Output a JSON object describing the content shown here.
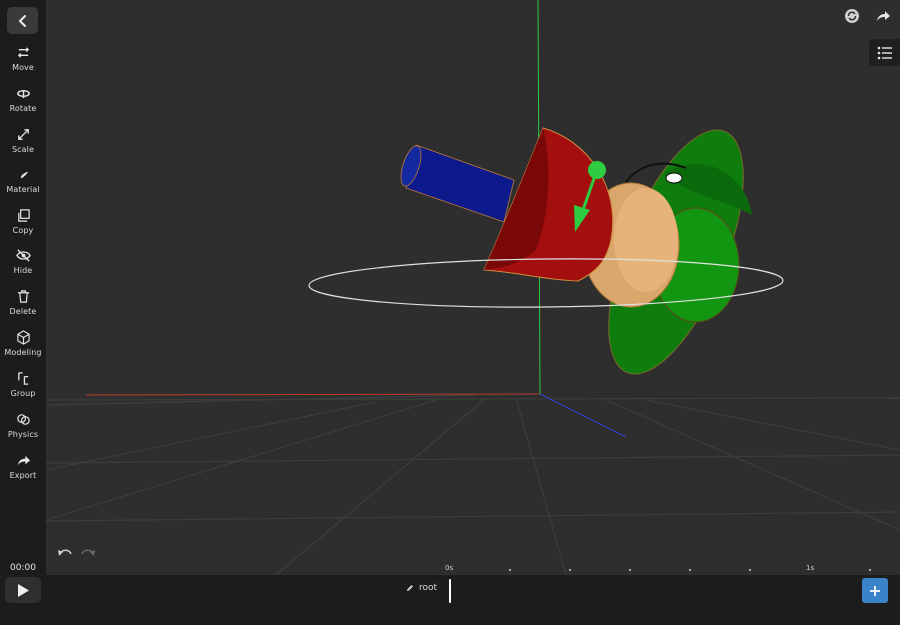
{
  "sidebar": {
    "tools": [
      {
        "label": "Move",
        "icon": "move-icon"
      },
      {
        "label": "Rotate",
        "icon": "rotate-icon"
      },
      {
        "label": "Scale",
        "icon": "scale-icon"
      },
      {
        "label": "Material",
        "icon": "brush-icon"
      },
      {
        "label": "Copy",
        "icon": "copy-icon"
      },
      {
        "label": "Hide",
        "icon": "eye-off-icon"
      },
      {
        "label": "Delete",
        "icon": "trash-icon"
      },
      {
        "label": "Modeling",
        "icon": "cube-icon"
      },
      {
        "label": "Group",
        "icon": "group-icon"
      },
      {
        "label": "Physics",
        "icon": "physics-icon"
      },
      {
        "label": "Export",
        "icon": "share-icon"
      }
    ]
  },
  "playback": {
    "time": "00:00"
  },
  "timeline": {
    "start_label": "0s",
    "end_label": "1s",
    "track_label": "root"
  },
  "colors": {
    "accent": "#3a83c8",
    "axis_x": "#c0392b",
    "axis_y": "#2ecc40",
    "axis_z": "#2b43c8"
  }
}
